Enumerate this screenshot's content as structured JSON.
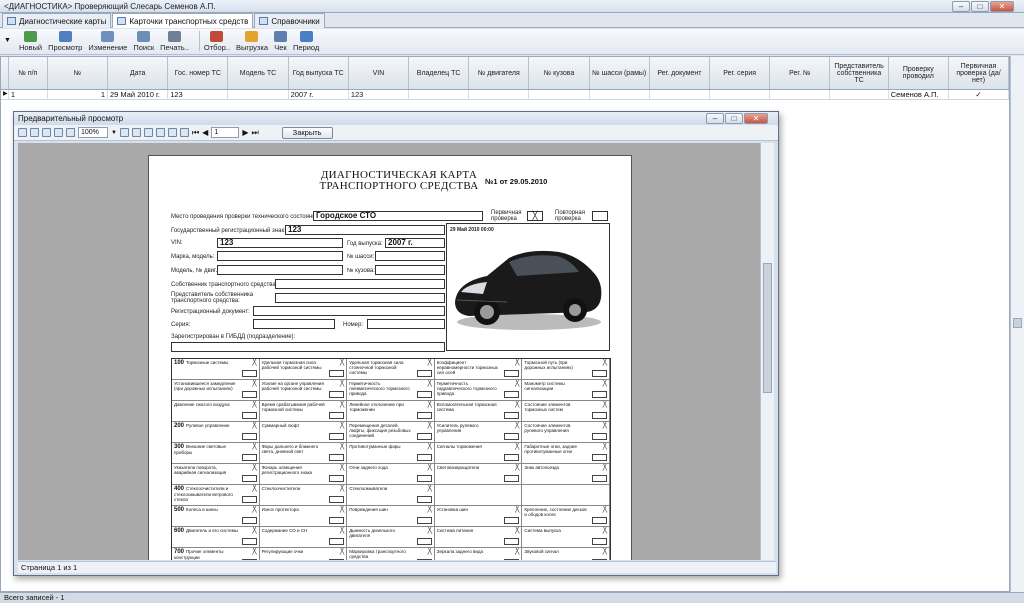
{
  "window": {
    "title": "<ДИАГНОСТИКА>   Проверяющий Слесарь Семенов А.П."
  },
  "tabs": [
    {
      "label": "Диагностические карты",
      "active": false
    },
    {
      "label": "Карточки транспортных средств",
      "active": true
    },
    {
      "label": "Справочники",
      "active": false
    }
  ],
  "toolbar": {
    "buttons": [
      {
        "label": "Новый",
        "color": "#4d9a4d"
      },
      {
        "label": "Просмотр",
        "color": "#4f7fbf"
      },
      {
        "label": "Изменение",
        "color": "#6f8fbf"
      },
      {
        "label": "Поиск",
        "color": "#6d8fb5"
      },
      {
        "label": "Печать..",
        "color": "#6f7f95"
      },
      {
        "label": "Отбор..",
        "color": "#c04b3a"
      },
      {
        "label": "Выгрузка",
        "color": "#e0a52a"
      },
      {
        "label": "Чек",
        "color": "#5f7fb0"
      },
      {
        "label": "Период",
        "color": "#4c7ec5"
      }
    ]
  },
  "grid": {
    "columns": [
      "№ п/п",
      "№",
      "Дата",
      "Гос. номер ТС",
      "Модель ТС",
      "Год выпуска ТС",
      "VIN",
      "Владелец ТС",
      "№ двигателя",
      "№ кузова",
      "№ шасси (рамы)",
      "Рег. документ",
      "Рег. серия",
      "Рег. №",
      "Представитель собственника ТС",
      "Проверку проводил",
      "Первичная проверка (да/нет)"
    ],
    "rows": [
      [
        "1",
        "1",
        "29 Май 2010 г.",
        "123",
        "",
        "2007 г.",
        "123",
        "",
        "",
        "",
        "",
        "",
        "",
        "",
        "",
        "Семенов А.П.",
        "✓"
      ]
    ]
  },
  "status": {
    "text": "Всего записей - 1"
  },
  "preview": {
    "title": "Предварительный просмотр",
    "zoom": "100%",
    "page_input": "1",
    "close_label": "Закрыть",
    "page_status": "Страница 1 из 1",
    "document": {
      "title_line1": "ДИАГНОСТИЧЕСКАЯ КАРТА",
      "title_line2": "ТРАНСПОРТНОГО СРЕДСТВА",
      "number": "№1 от 29.05.2010",
      "place_label": "Место проведения проверки технического состояния:",
      "place_value": "Городское СТО",
      "primary_label": "Первичная проверка",
      "repeat_label": "Повторная проверка",
      "reg_sign_label": "Государственный регистрационный знак:",
      "reg_sign_value": "123",
      "vin_label": "VIN:",
      "vin_value": "123",
      "year_label": "Год выпуска:",
      "year_value": "2007 г.",
      "make_label": "Марка, модель:",
      "chassis_label": "№ шасси:",
      "model_engine_label": "Модель, № двиг.",
      "body_label": "№ кузова:",
      "owner_label": "Собственник транспортного средства:",
      "rep_label": "Представитель собственника транспортного средства:",
      "regdoc_label": "Регистрационный документ:",
      "series_label": "Серия:",
      "number_label": "Номер:",
      "gibdd_label": "Зарегистрирован в ГИБДД (подразделение):",
      "photo_timestamp": "29 Май 2010 00:00",
      "cells": [
        {
          "code": "100",
          "text": "Тормозные системы"
        },
        {
          "code": "",
          "text": "Удельная тормозная сила рабочей тормозной системы"
        },
        {
          "code": "",
          "text": "Удельная тормозная сила стояночной тормозной системы"
        },
        {
          "code": "",
          "text": "Коэффициент неравномерности тормозных сил осей"
        },
        {
          "code": "",
          "text": "Тормозной путь (при дорожных испытаниях)"
        },
        {
          "code": "",
          "text": "Установившееся замедление (при дорожных испытаниях)"
        },
        {
          "code": "",
          "text": "Усилие на органе управления рабочей тормозной системы"
        },
        {
          "code": "",
          "text": "Герметичность пневматического тормозного привода"
        },
        {
          "code": "",
          "text": "Герметичность гидравлического тормозного привода"
        },
        {
          "code": "",
          "text": "Манометр системы сигнализации"
        },
        {
          "code": "",
          "text": "Давление сжатого воздуха"
        },
        {
          "code": "",
          "text": "Время срабатывания рабочей тормозной системы"
        },
        {
          "code": "",
          "text": "Линейное отклонение при торможении"
        },
        {
          "code": "",
          "text": "Вспомогательная тормозная система"
        },
        {
          "code": "",
          "text": "Состояние элементов тормозных систем"
        },
        {
          "code": "200",
          "text": "Рулевое управление"
        },
        {
          "code": "",
          "text": "Суммарный люфт"
        },
        {
          "code": "",
          "text": "Перемещения деталей, люфты, фиксация резьбовых соединений"
        },
        {
          "code": "",
          "text": "Усилитель рулевого управления"
        },
        {
          "code": "",
          "text": "Состояние элементов рулевого управления"
        },
        {
          "code": "300",
          "text": "Внешние световые приборы"
        },
        {
          "code": "",
          "text": "Фары дальнего и ближнего света, дневной свет"
        },
        {
          "code": "",
          "text": "Противотуманные фары"
        },
        {
          "code": "",
          "text": "Сигналы торможения"
        },
        {
          "code": "",
          "text": "Габаритные огни, задние противотуманные огни"
        },
        {
          "code": "",
          "text": "Указатели поворота, аварийная сигнализация"
        },
        {
          "code": "",
          "text": "Фонарь освещения регистрационного знака"
        },
        {
          "code": "",
          "text": "Огни заднего хода"
        },
        {
          "code": "",
          "text": "Световозвращатели"
        },
        {
          "code": "",
          "text": "Знак автопоезда"
        },
        {
          "code": "400",
          "text": "Стеклоочистители и стеклоомыватели ветрового стекла"
        },
        {
          "code": "",
          "text": "Стеклоочистители"
        },
        {
          "code": "",
          "text": "Стеклоомыватели"
        },
        {
          "code": "",
          "text": ""
        },
        {
          "code": "",
          "text": ""
        },
        {
          "code": "500",
          "text": "Колеса и шины"
        },
        {
          "code": "",
          "text": "Износ протектора"
        },
        {
          "code": "",
          "text": "Повреждения шин"
        },
        {
          "code": "",
          "text": "Установка шин"
        },
        {
          "code": "",
          "text": "Крепление, состояние дисков и ободов колес"
        },
        {
          "code": "600",
          "text": "Двигатель и его системы"
        },
        {
          "code": "",
          "text": "Содержание СО и СН"
        },
        {
          "code": "",
          "text": "Дымность дизельного двигателя"
        },
        {
          "code": "",
          "text": "Система питания"
        },
        {
          "code": "",
          "text": "Система выпуска"
        },
        {
          "code": "700",
          "text": "Прочие элементы конструкции"
        },
        {
          "code": "",
          "text": "Регулирующие очки"
        },
        {
          "code": "",
          "text": "Маркировка транспортного средства"
        },
        {
          "code": "",
          "text": "Зеркала заднего вида"
        },
        {
          "code": "",
          "text": "Звуковой сигнал"
        }
      ]
    }
  }
}
